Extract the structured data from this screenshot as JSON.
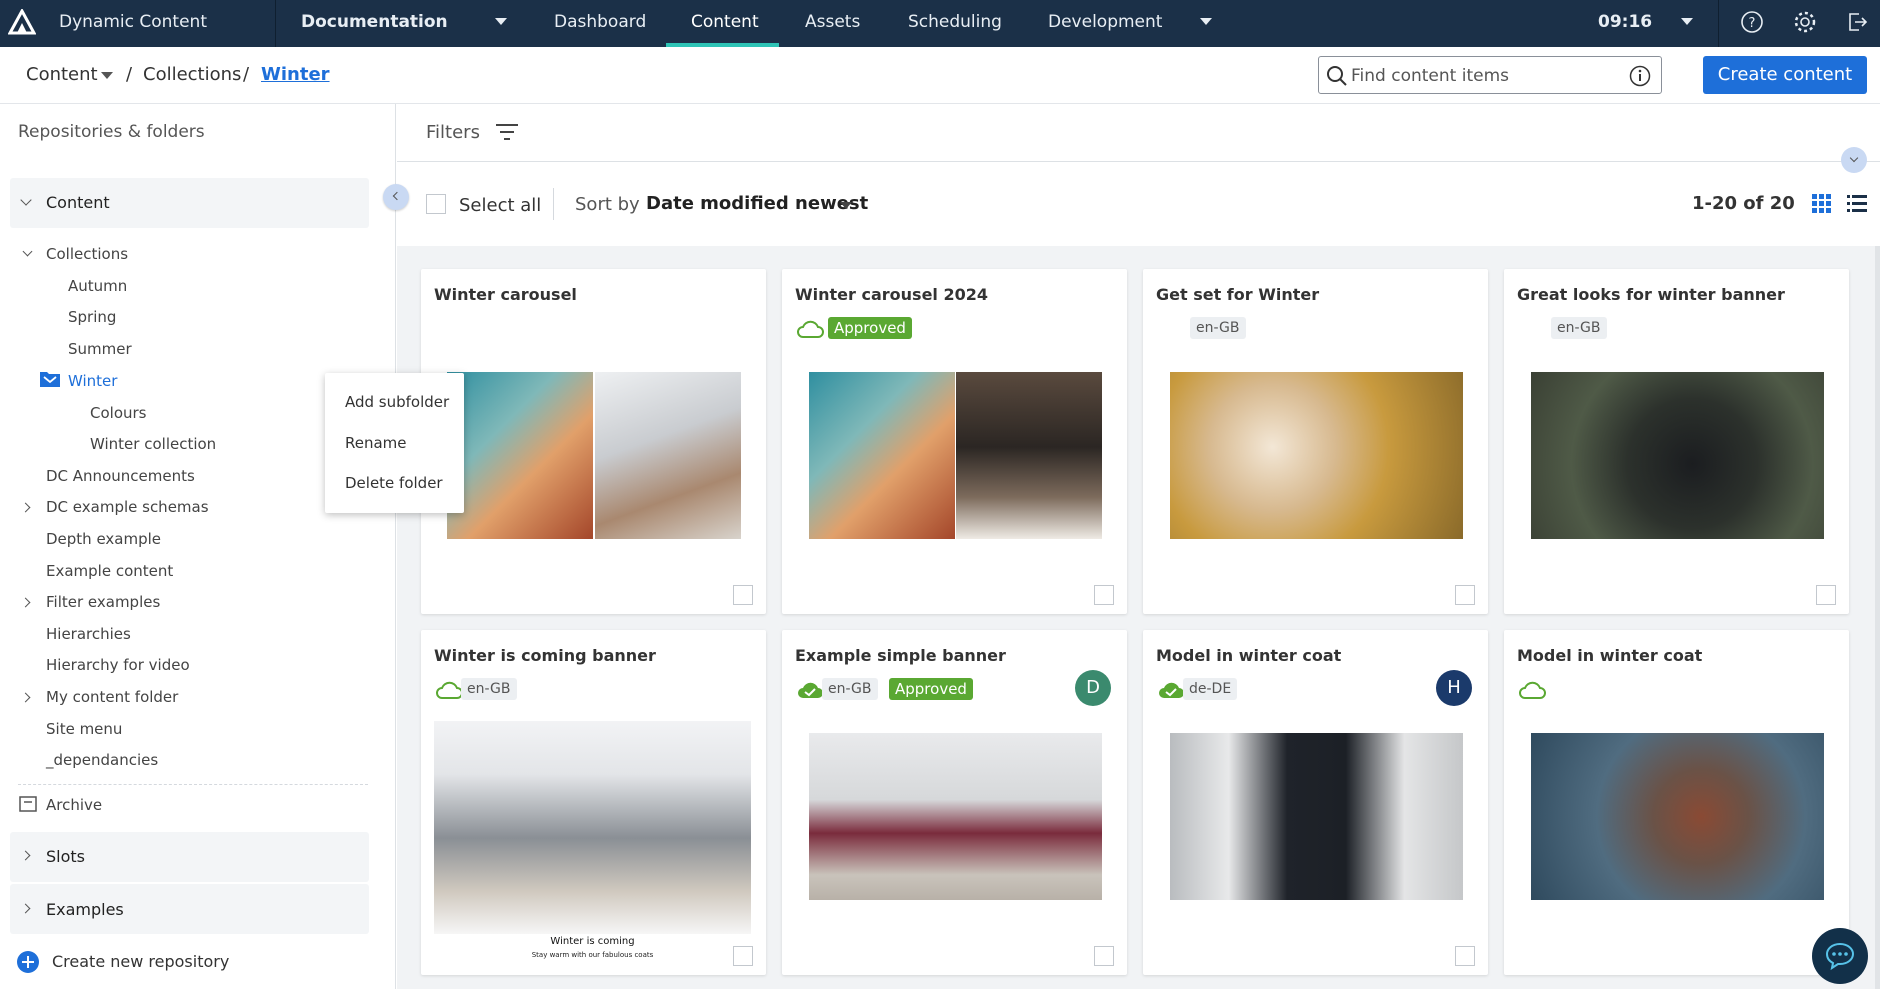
{
  "topbar": {
    "app_name": "Dynamic Content",
    "hub_name": "Documentation",
    "tabs": [
      {
        "label": "Dashboard"
      },
      {
        "label": "Content"
      },
      {
        "label": "Assets"
      },
      {
        "label": "Scheduling"
      },
      {
        "label": "Development"
      }
    ],
    "time": "09:16"
  },
  "breadcrumb": {
    "root": "Content",
    "sep1": "/",
    "collections": "Collections",
    "sep2": "/",
    "current": "Winter"
  },
  "search": {
    "placeholder": "Find content items"
  },
  "create_button": "Create content",
  "sidebar": {
    "header": "Repositories & folders",
    "content_repo": "Content",
    "tree": {
      "collections": "Collections",
      "autumn": "Autumn",
      "spring": "Spring",
      "summer": "Summer",
      "winter": "Winter",
      "colours": "Colours",
      "winter_collection": "Winter collection",
      "dc_announcements": "DC Announcements",
      "dc_example_schemas": "DC example schemas",
      "depth_example": "Depth example",
      "example_content": "Example content",
      "filter_examples": "Filter examples",
      "hierarchies": "Hierarchies",
      "hierarchy_for_video": "Hierarchy for video",
      "my_content_folder": "My content folder",
      "site_menu": "Site menu",
      "dependancies": "_dependancies"
    },
    "archive": "Archive",
    "slots": "Slots",
    "examples": "Examples",
    "create_repo": "Create new repository"
  },
  "context_menu": {
    "add_subfolder": "Add subfolder",
    "rename": "Rename",
    "delete_folder": "Delete folder"
  },
  "toolbar": {
    "filters": "Filters",
    "select_all": "Select all",
    "sort_by": "Sort by",
    "sort_value": "Date modified newest",
    "pagination": "1-20 of 20"
  },
  "cards": [
    {
      "title": "Winter carousel"
    },
    {
      "title": "Winter carousel 2024",
      "status": "Approved"
    },
    {
      "title": "Get set for Winter",
      "locale": "en-GB"
    },
    {
      "title": "Great looks for winter banner",
      "locale": "en-GB"
    },
    {
      "title": "Winter is coming banner",
      "locale": "en-GB",
      "caption": "Winter is coming",
      "subcaption": "Stay warm with our fabulous coats"
    },
    {
      "title": "Example simple banner",
      "locale": "en-GB",
      "status": "Approved",
      "avatar": "D"
    },
    {
      "title": "Model in winter coat",
      "locale": "de-DE",
      "avatar": "H"
    },
    {
      "title": "Model in winter coat"
    }
  ],
  "colors": {
    "topbar": "#1b3048",
    "accent": "#2ec4b6",
    "primary": "#1e6fd9",
    "approved": "#5aa832",
    "avatar_d": "#3b8a6e",
    "avatar_h": "#1b3a6b"
  }
}
